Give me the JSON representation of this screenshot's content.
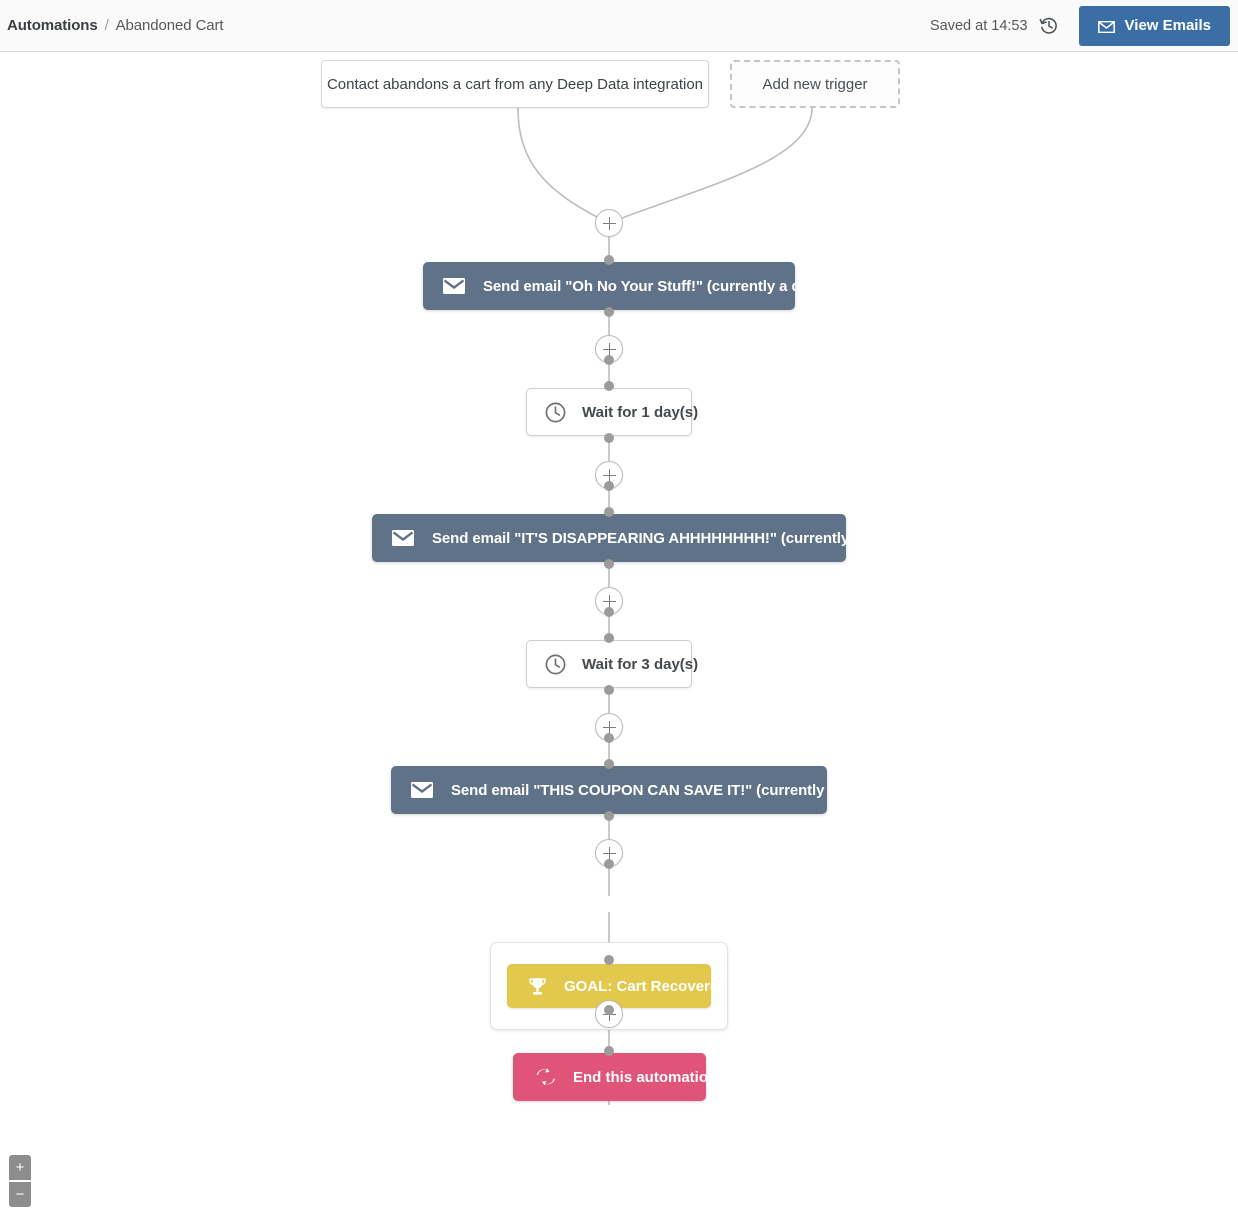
{
  "header": {
    "breadcrumb_root": "Automations",
    "breadcrumb_separator": "/",
    "breadcrumb_current": "Abandoned Cart",
    "saved_status": "Saved at 14:53",
    "history_icon": "history-clock-icon",
    "view_emails_label": "View Emails",
    "view_emails_icon": "envelope-icon",
    "accent_color": "#3b6ea5",
    "background": "#fafafa"
  },
  "triggers": [
    {
      "label": "Contact abandons a cart from any Deep Data integration",
      "style": "solid"
    },
    {
      "label": "Add new trigger",
      "style": "dashed"
    }
  ],
  "steps": [
    {
      "type": "email",
      "icon": "envelope-icon",
      "label": "Send email \"Oh No Your Stuff!\" (currently a draft)",
      "color": "#5f7287"
    },
    {
      "type": "wait",
      "icon": "clock-icon",
      "label": "Wait for 1 day(s)",
      "color": "#ffffff"
    },
    {
      "type": "email",
      "icon": "envelope-icon",
      "label": "Send email \"IT'S DISAPPEARING AHHHHHHHH!\" (currently a draft)",
      "color": "#5f7287"
    },
    {
      "type": "wait",
      "icon": "clock-icon",
      "label": "Wait for 3 day(s)",
      "color": "#ffffff"
    },
    {
      "type": "email",
      "icon": "envelope-icon",
      "label": "Send email \"THIS COUPON CAN SAVE IT!\" (currently a draft)",
      "color": "#5f7287"
    },
    {
      "type": "goal",
      "icon": "trophy-icon",
      "label": "GOAL: Cart Recovered",
      "color": "#e3c84e"
    },
    {
      "type": "end",
      "icon": "exchange-arrows-icon",
      "label": "End this automation",
      "color": "#e0547a"
    }
  ],
  "add_step_buttons": {
    "label": "+",
    "icon": "plus-icon",
    "count": 6
  },
  "zoom_controls": {
    "zoom_in_label": "+",
    "zoom_in_icon": "plus-icon",
    "zoom_out_label": "−",
    "zoom_out_icon": "minus-icon"
  }
}
